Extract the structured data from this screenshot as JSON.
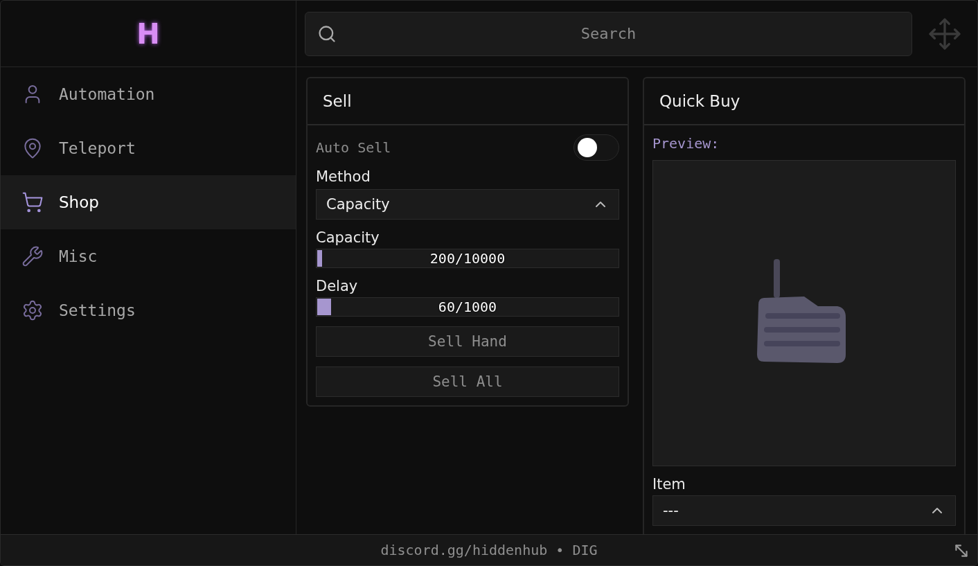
{
  "brand": {
    "logo": "H"
  },
  "sidebar": {
    "items": [
      {
        "label": "Automation",
        "kind": "user",
        "selected": false
      },
      {
        "label": "Teleport",
        "kind": "pin",
        "selected": false
      },
      {
        "label": "Shop",
        "kind": "cart",
        "selected": true
      },
      {
        "label": "Misc",
        "kind": "wrench",
        "selected": false
      },
      {
        "label": "Settings",
        "kind": "gear",
        "selected": false
      }
    ]
  },
  "search": {
    "placeholder": "Search"
  },
  "sell": {
    "title": "Sell",
    "toggle": {
      "label": "Auto Sell",
      "on": false
    },
    "method": {
      "label": "Method",
      "value": "Capacity"
    },
    "sliders": [
      {
        "label": "Capacity",
        "reading": "200/10000",
        "level": 0.02
      },
      {
        "label": "Delay",
        "reading": "60/1000",
        "level": 0.05
      }
    ],
    "buttons": [
      "Sell Hand",
      "Sell All"
    ]
  },
  "quick_buy": {
    "title": "Quick Buy",
    "preview_label": "Preview:",
    "item": {
      "label": "Item",
      "value": "---"
    }
  },
  "status_bar": "discord.gg/hiddenhub • DIG"
}
